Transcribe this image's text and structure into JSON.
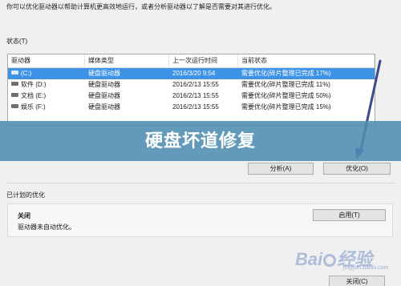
{
  "intro_text": "你可以优化驱动器以帮助计算机更高效地运行，或者分析驱动器以了解是否需要对其进行优化。",
  "status": {
    "label": "状态(T)",
    "columns": [
      "驱动器",
      "媒体类型",
      "上一次运行时间",
      "当前状态"
    ],
    "rows": [
      {
        "drive": "(C:)",
        "media": "硬盘驱动器",
        "last_run": "2016/3/20 9:54",
        "status": "需要优化(碎片整理已完成 17%)",
        "selected": true
      },
      {
        "drive": "软件 (D:)",
        "media": "硬盘驱动器",
        "last_run": "2016/2/13 15:55",
        "status": "需要优化(碎片整理已完成 11%)",
        "selected": false
      },
      {
        "drive": "文档 (E:)",
        "media": "硬盘驱动器",
        "last_run": "2016/2/13 15:55",
        "status": "需要优化(碎片整理已完成 50%)",
        "selected": false
      },
      {
        "drive": "娱乐 (F:)",
        "media": "硬盘驱动器",
        "last_run": "2016/2/13 15:55",
        "status": "需要优化(碎片整理已完成 15%)",
        "selected": false
      }
    ]
  },
  "buttons": {
    "analyze": "分析(A)",
    "optimize": "优化(O)",
    "enable": "启用(T)",
    "close": "关闭(C)"
  },
  "scheduled": {
    "label": "已计划的优化",
    "state": "关闭",
    "description": "驱动器未自动优化。"
  },
  "banner_title": "硬盘坏道修复",
  "watermark": {
    "text_left": "Bai",
    "text_right": "经验",
    "sub": "jingyan.baidu.com"
  },
  "colors": {
    "selection": "#3e93e6",
    "banner": "#4e8db2",
    "arrow": "#3a4a8a"
  }
}
